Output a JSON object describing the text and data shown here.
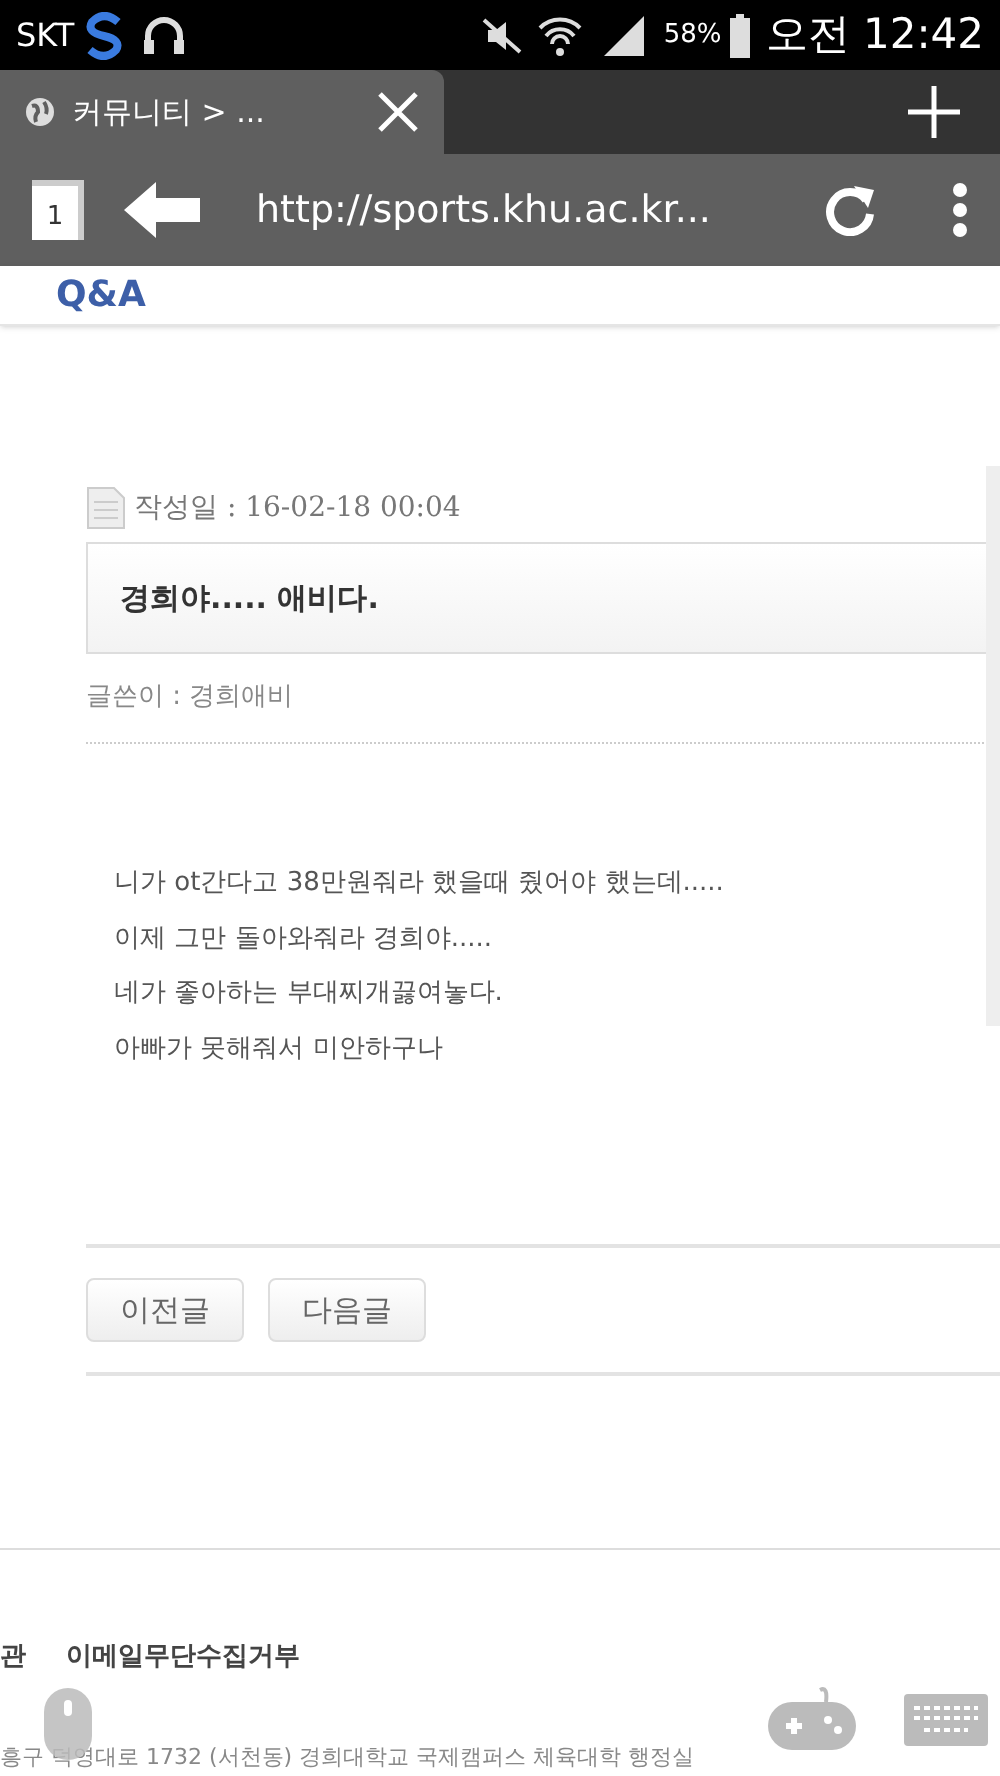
{
  "status_bar": {
    "carrier": "SKT",
    "battery": "58%",
    "time": "오전 12:42"
  },
  "browser": {
    "tab_title": "커뮤니티 > ...",
    "tab_count": "1",
    "url": "http://sports.khu.ac.kr..."
  },
  "page": {
    "heading": "Q&A",
    "date": "작성일 : 16-02-18 00:04",
    "title": "경희야..... 애비다.",
    "author": "글쓴이 : 경희애비",
    "body": [
      "니가 ot간다고 38만원줘라 했을때 줬어야 했는데.....",
      "이제 그만 돌아와줘라 경희야.....",
      "네가 좋아하는 부대찌개끓여놓다.",
      "아빠가 못해줘서 미안하구나"
    ],
    "buttons": [
      "이전글",
      "다음글"
    ]
  },
  "footer": {
    "links": [
      "관",
      "이메일무단수집거부"
    ],
    "address": "흥구 덕영대로 1732 (서천동) 경희대학교 국제캠퍼스 체육대학 행정실"
  }
}
